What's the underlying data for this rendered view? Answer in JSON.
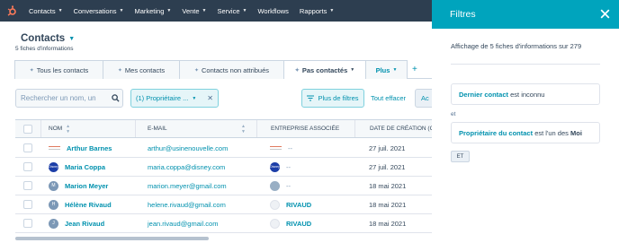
{
  "nav": {
    "items": [
      {
        "label": "Contacts",
        "has_menu": true
      },
      {
        "label": "Conversations",
        "has_menu": true
      },
      {
        "label": "Marketing",
        "has_menu": true
      },
      {
        "label": "Vente",
        "has_menu": true
      },
      {
        "label": "Service",
        "has_menu": true
      },
      {
        "label": "Workflows",
        "has_menu": false
      },
      {
        "label": "Rapports",
        "has_menu": true
      }
    ],
    "logo_icon": "sprocket-icon",
    "logo_color": "#ff7a59"
  },
  "header": {
    "title": "Contacts",
    "subtitle": "5 fiches d'informations"
  },
  "tabs": [
    {
      "label": "Tous les contacts",
      "active": false
    },
    {
      "label": "Mes contacts",
      "active": false
    },
    {
      "label": "Contacts non attribués",
      "active": false
    },
    {
      "label": "Pas contactés",
      "active": true
    }
  ],
  "tab_more": "Plus",
  "toolbar": {
    "search_placeholder": "Rechercher un nom, un",
    "filter_chip": "(1) Propriétaire ...",
    "more_filters": "Plus de filtres",
    "clear_all": "Tout effacer",
    "cut_button": "Ac"
  },
  "table": {
    "columns": {
      "name": "NOM",
      "email": "E-MAIL",
      "company": "ENTREPRISE ASSOCIÉE",
      "created": "DATE DE CRÉATION (G"
    },
    "rows": [
      {
        "name": "Arthur Barnes",
        "email": "arthur@usinenouvelle.com",
        "avatar": "company-logo",
        "company": "--",
        "company_avatar": "company-logo",
        "created": "27 juil. 2021"
      },
      {
        "name": "Maria Coppa",
        "email": "maria.coppa@disney.com",
        "avatar": "disney-logo",
        "avatar_text": "Disney",
        "company": "--",
        "company_avatar": "disney-logo",
        "created": "27 juil. 2021"
      },
      {
        "name": "Marion Meyer",
        "email": "marion.meyer@gmail.com",
        "avatar": "initial",
        "avatar_text": "M",
        "company": "--",
        "company_avatar": "blank",
        "created": "18 mai 2021"
      },
      {
        "name": "Hélène Rivaud",
        "email": "helene.rivaud@gmail.com",
        "avatar": "initial",
        "avatar_text": "H",
        "company": "RIVAUD",
        "company_avatar": "cloud",
        "created": "18 mai 2021"
      },
      {
        "name": "Jean Rivaud",
        "email": "jean.rivaud@gmail.com",
        "avatar": "initial",
        "avatar_text": "J",
        "company": "RIVAUD",
        "company_avatar": "cloud",
        "created": "18 mai 2021"
      }
    ]
  },
  "panel": {
    "title": "Filtres",
    "info": "Affichage de 5 fiches d'informations sur 279",
    "filters": [
      {
        "property": "Dernier contact",
        "condition": " est inconnu",
        "value": ""
      },
      {
        "property": "Propriétaire du contact",
        "condition": " est l'un des ",
        "value": "Moi"
      }
    ],
    "and_label": "et",
    "and_button": "ET",
    "header_color": "#00a4bd"
  },
  "colors": {
    "nav_bg": "#2d3e50",
    "link": "#0091ae",
    "text": "#33475b"
  }
}
